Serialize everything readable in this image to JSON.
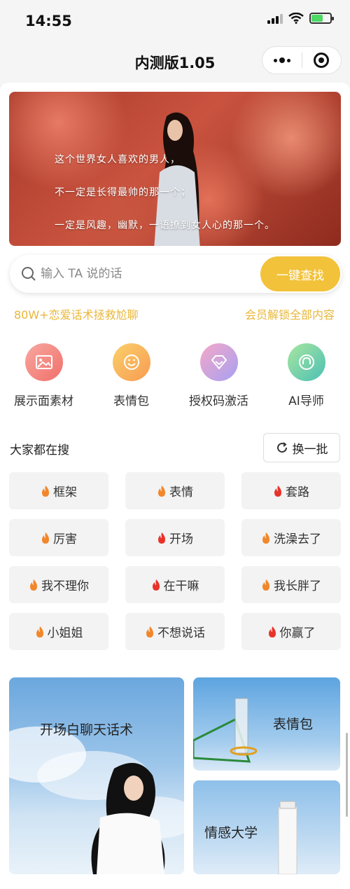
{
  "status_bar": {
    "time": "14:55"
  },
  "nav": {
    "title": "内测版1.05"
  },
  "banner": {
    "lines": [
      "这个世界女人喜欢的男人，",
      "不一定是长得最帅的那一个；",
      "一定是风趣，幽默，一语撩到女人心的那一个。"
    ]
  },
  "search": {
    "placeholder": "输入 TA 说的话",
    "button": "一键查找"
  },
  "promo": {
    "left": "80W+恋爱话术拯救尬聊",
    "right": "会员解锁全部内容"
  },
  "features": [
    {
      "label": "展示面素材",
      "icon": "image-icon"
    },
    {
      "label": "表情包",
      "icon": "smile-icon"
    },
    {
      "label": "授权码激活",
      "icon": "diamond-icon"
    },
    {
      "label": "AI导师",
      "icon": "headset-icon"
    }
  ],
  "hot_search": {
    "title": "大家都在搜",
    "refresh": "换一批",
    "items": [
      "框架",
      "表情",
      "套路",
      "厉害",
      "开场",
      "洗澡去了",
      "我不理你",
      "在干嘛",
      "我长胖了",
      "小姐姐",
      "不想说话",
      "你赢了"
    ]
  },
  "cards": {
    "big": "开场白聊天话术",
    "small1": "表情包",
    "small2": "情感大学"
  },
  "colors": {
    "accent": "#f2c23a",
    "promo": "#e8b73a",
    "flame_orange": "#f2862a",
    "flame_red": "#e8332a"
  }
}
